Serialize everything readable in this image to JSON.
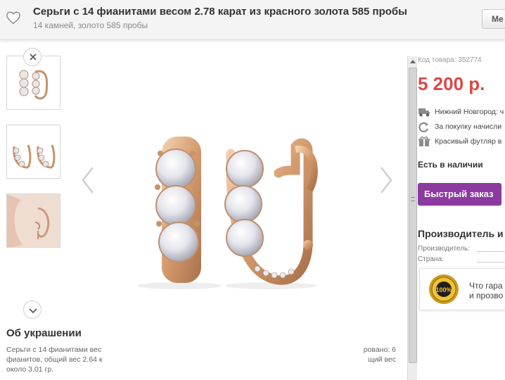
{
  "header": {
    "title": "Серьги с 14 фианитами весом 2.78 карат из красного золота 585 пробы",
    "subtitle": "14 камней, золото 585 пробы",
    "right_button_label": "Ме"
  },
  "gallery": {
    "thumbnails": [
      {
        "icon": "earrings-front-thumbnail"
      },
      {
        "icon": "earrings-side-thumbnail"
      },
      {
        "icon": "earring-on-ear-thumbnail"
      }
    ]
  },
  "about": {
    "title": "Об украшении",
    "text_left": "Серьги с 14 фианитами вес фианитов, общий вес 2.64 к около 3.01 гр.",
    "text_right": "ровано: 6 щий вес"
  },
  "product": {
    "sku": "Код товара: 352774",
    "price": "5 200 р.",
    "info": [
      {
        "icon": "truck-icon",
        "text": "Нижний Новгород: ч"
      },
      {
        "icon": "refresh-icon",
        "text": "За покупку начисли"
      },
      {
        "icon": "gift-icon",
        "text": "Красивый футляр в"
      }
    ],
    "stock": "Есть в наличии",
    "quick_order_label": "Быстрый заказ",
    "manufacturer": {
      "title": "Производитель и",
      "rows": [
        "Производитель:",
        "Страна:"
      ]
    },
    "guarantee": {
      "line1": "Что гара",
      "line2": "и прозво",
      "seal_text": "100%"
    }
  },
  "colors": {
    "price": "#e04646",
    "quick_button": "#8c3aa0",
    "gold": "#d9a97a"
  }
}
